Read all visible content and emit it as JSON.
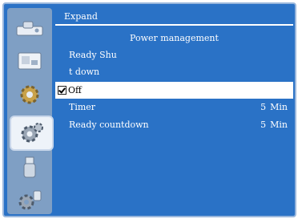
{
  "header": {
    "title": "Expand"
  },
  "section": {
    "title": "Power management"
  },
  "rows": {
    "ready_shu": "Ready  Shu",
    "t_down": "t down",
    "off": "Off",
    "timer": {
      "label": "Timer",
      "value": "5",
      "unit": "Min"
    },
    "ready_countdown": {
      "label": "Ready countdown",
      "value": "5",
      "unit": "Min"
    }
  },
  "sidebar": {
    "items": [
      {
        "icon": "input-icon"
      },
      {
        "icon": "picture-icon"
      },
      {
        "icon": "settings-icon"
      },
      {
        "icon": "expand-settings-icon"
      },
      {
        "icon": "usb-icon"
      },
      {
        "icon": "network-icon"
      }
    ]
  },
  "colors": {
    "panel": "#2a72c6",
    "sidebar": "#7f9fc4",
    "selection": "#ffffff",
    "text": "#ffffff"
  }
}
